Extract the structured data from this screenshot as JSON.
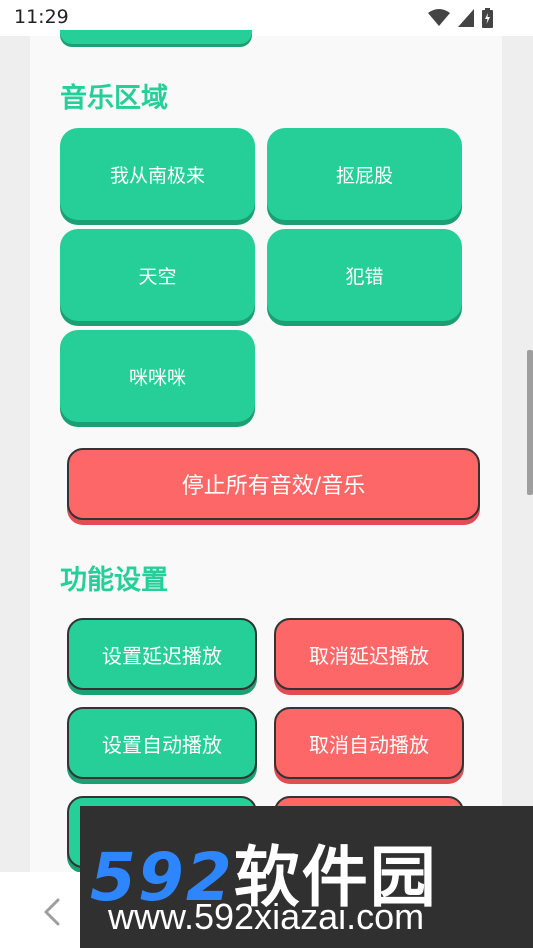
{
  "status_bar": {
    "time": "11:29"
  },
  "music_section": {
    "title": "音乐区域",
    "buttons": [
      "我从南极来",
      "抠屁股",
      "天空",
      "犯错",
      "咪咪咪"
    ]
  },
  "stop_all_label": "停止所有音效/音乐",
  "settings_section": {
    "title": "功能设置",
    "set_delay": "设置延迟播放",
    "cancel_delay": "取消延迟播放",
    "set_auto": "设置自动播放",
    "cancel_auto": "取消自动播放"
  },
  "watermark": {
    "brand_num": "592",
    "brand_cn": "软件园",
    "url": "www.592xiazai.com"
  },
  "colors": {
    "accent_green": "#26cf97",
    "accent_red": "#fe6767"
  }
}
